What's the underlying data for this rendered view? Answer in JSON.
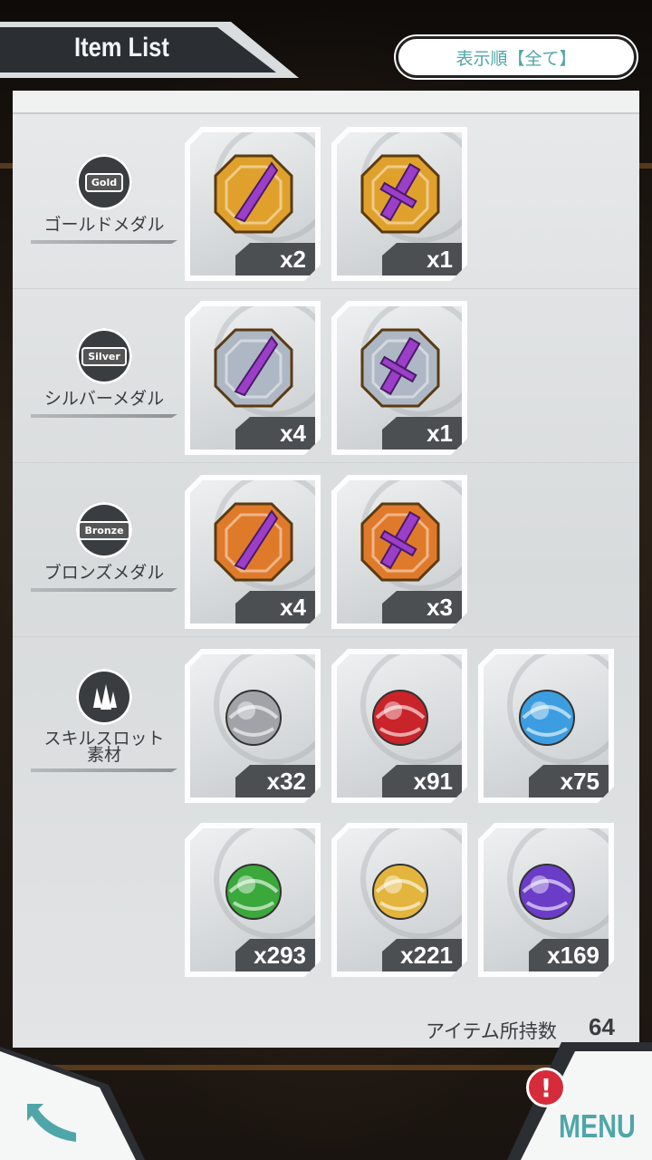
{
  "header": {
    "title": "Item List",
    "sort_button": "表示順【全て】"
  },
  "categories": [
    {
      "label": "ゴールドメダル",
      "icon": "gold-medal-icon",
      "badge": "Gold"
    },
    {
      "label": "シルバーメダル",
      "icon": "silver-medal-icon",
      "badge": "Silver"
    },
    {
      "label": "ブロンズメダル",
      "icon": "bronze-medal-icon",
      "badge": "Bronze"
    },
    {
      "label": "スキルスロット\n素材",
      "icon": "crystal-icon",
      "badge": ""
    }
  ],
  "items": [
    {
      "name": "gold-lance-medal",
      "qty": "x2",
      "icon": "lance-icon",
      "color": "#e0a12c"
    },
    {
      "name": "gold-sword-medal",
      "qty": "x1",
      "icon": "sword-icon",
      "color": "#e0a12c"
    },
    {
      "name": "silver-lance-medal",
      "qty": "x4",
      "icon": "lance-icon",
      "color": "#aeb8c4"
    },
    {
      "name": "silver-sword-medal",
      "qty": "x1",
      "icon": "sword-icon",
      "color": "#aeb8c4"
    },
    {
      "name": "bronze-lance-medal",
      "qty": "x4",
      "icon": "lance-icon",
      "color": "#e07a2b"
    },
    {
      "name": "bronze-sword-medal",
      "qty": "x3",
      "icon": "sword-icon",
      "color": "#e07a2b"
    },
    {
      "name": "silver-orb",
      "qty": "x32",
      "icon": "orb-icon",
      "color": "#a0a3a8"
    },
    {
      "name": "red-orb",
      "qty": "x91",
      "icon": "orb-icon",
      "color": "#c8242a"
    },
    {
      "name": "blue-orb",
      "qty": "x75",
      "icon": "orb-icon",
      "color": "#3c9ee0"
    },
    {
      "name": "green-orb",
      "qty": "x293",
      "icon": "orb-icon",
      "color": "#3aa83a"
    },
    {
      "name": "gold-orb",
      "qty": "x221",
      "icon": "orb-icon",
      "color": "#e3b53d"
    },
    {
      "name": "purple-orb",
      "qty": "x169",
      "icon": "orb-icon",
      "color": "#6b3cc8"
    }
  ],
  "footer": {
    "owned_label": "アイテム所持数",
    "owned_count": "64",
    "menu_label": "MENU",
    "alert": "!"
  }
}
